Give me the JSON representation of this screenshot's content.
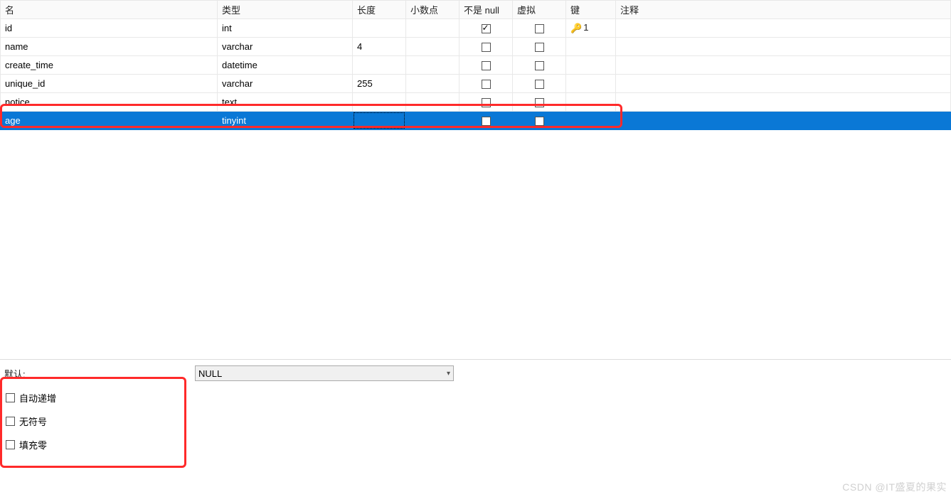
{
  "headers": {
    "name": "名",
    "type": "类型",
    "length": "长度",
    "decimal": "小数点",
    "notnull": "不是 null",
    "virtual": "虚拟",
    "key": "键",
    "comment": "注释"
  },
  "rows": [
    {
      "name": "id",
      "type": "int",
      "length": "",
      "decimal": "",
      "notnull": true,
      "virtual": false,
      "key": "1",
      "comment": "",
      "selected": false
    },
    {
      "name": "name",
      "type": "varchar",
      "length": "4",
      "decimal": "",
      "notnull": false,
      "virtual": false,
      "key": "",
      "comment": "",
      "selected": false
    },
    {
      "name": "create_time",
      "type": "datetime",
      "length": "",
      "decimal": "",
      "notnull": false,
      "virtual": false,
      "key": "",
      "comment": "",
      "selected": false
    },
    {
      "name": "unique_id",
      "type": "varchar",
      "length": "255",
      "decimal": "",
      "notnull": false,
      "virtual": false,
      "key": "",
      "comment": "",
      "selected": false
    },
    {
      "name": "notice",
      "type": "text",
      "length": "",
      "decimal": "",
      "notnull": false,
      "virtual": false,
      "key": "",
      "comment": "",
      "selected": false
    },
    {
      "name": "age",
      "type": "tinyint",
      "length": "",
      "decimal": "",
      "notnull": false,
      "virtual": false,
      "key": "",
      "comment": "",
      "selected": true
    }
  ],
  "bottom": {
    "default_label": "默认:",
    "default_value": "NULL",
    "options": {
      "auto_increment": "自动递增",
      "unsigned": "无符号",
      "zerofill": "填充零"
    }
  },
  "watermark": "CSDN @IT盛夏的果实"
}
